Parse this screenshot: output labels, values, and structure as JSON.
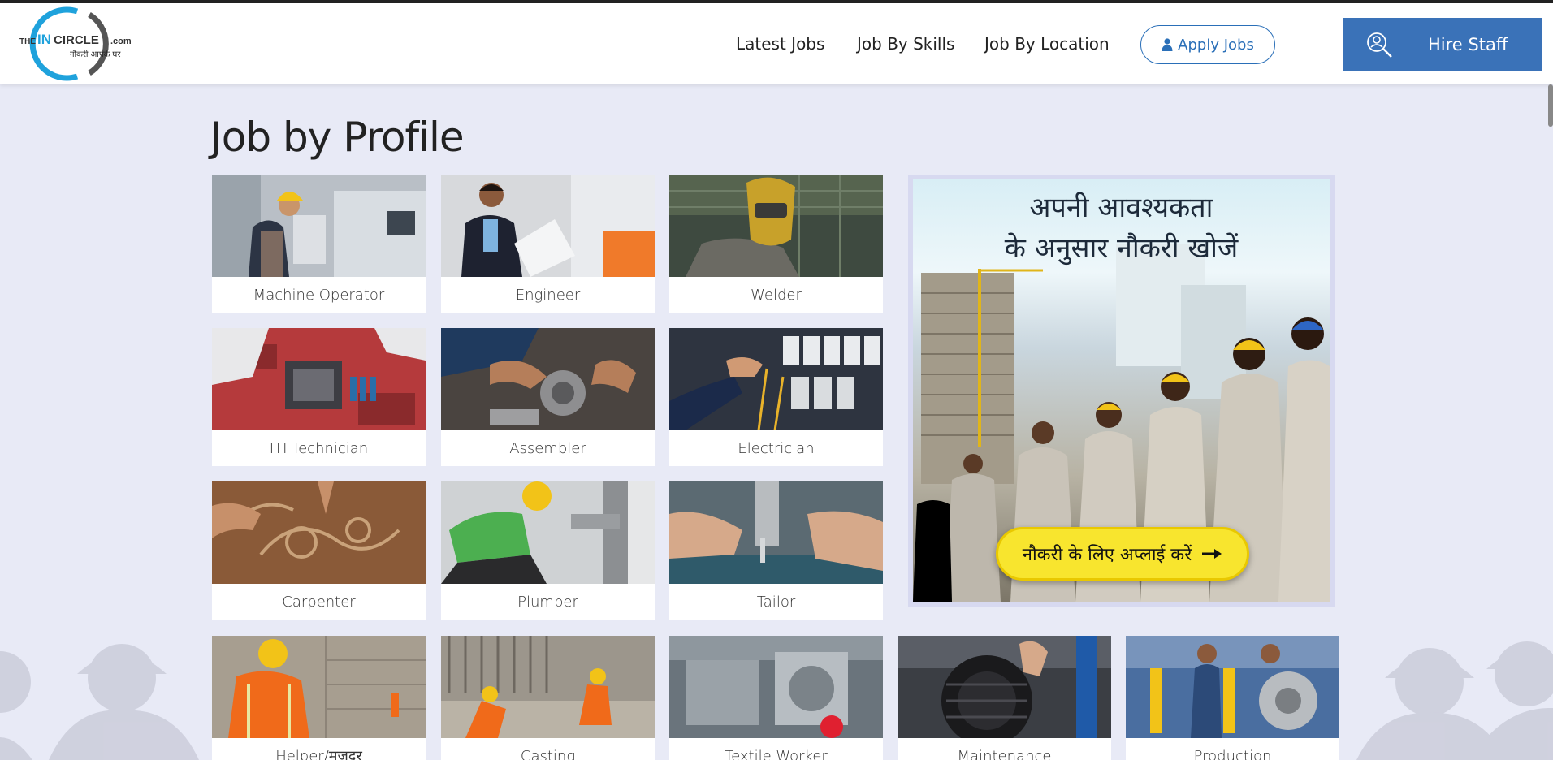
{
  "header": {
    "logo": {
      "brand_prefix": "THE",
      "brand_in": "IN",
      "brand_rest": "CIRCLE",
      "brand_tld": ".com",
      "tagline": "नौकरी आपके घर"
    },
    "nav": [
      {
        "label": "Latest Jobs"
      },
      {
        "label": "Job By Skills"
      },
      {
        "label": "Job By Location"
      }
    ],
    "apply_label": "Apply Jobs",
    "hire_label": "Hire Staff"
  },
  "main": {
    "title": "Job by Profile",
    "profiles": [
      {
        "label": "Machine Operator"
      },
      {
        "label": "Engineer"
      },
      {
        "label": "Welder"
      },
      {
        "label": "ITI Technician"
      },
      {
        "label": "Assembler"
      },
      {
        "label": "Electrician"
      },
      {
        "label": "Carpenter"
      },
      {
        "label": "Plumber"
      },
      {
        "label": "Tailor"
      },
      {
        "label": "Helper/मजदूर"
      },
      {
        "label": "Casting"
      },
      {
        "label": "Textile Worker"
      },
      {
        "label": "Maintenance"
      },
      {
        "label": "Production"
      }
    ]
  },
  "banner": {
    "title_line1": "अपनी आवश्यकता",
    "title_line2": "के अनुसार नौकरी खोजें",
    "cta_label": "नौकरी के लिए अप्लाई करें"
  },
  "colors": {
    "background": "#e8eaf6",
    "primary_blue": "#3a72b8",
    "cta_yellow": "#f8e52e"
  }
}
